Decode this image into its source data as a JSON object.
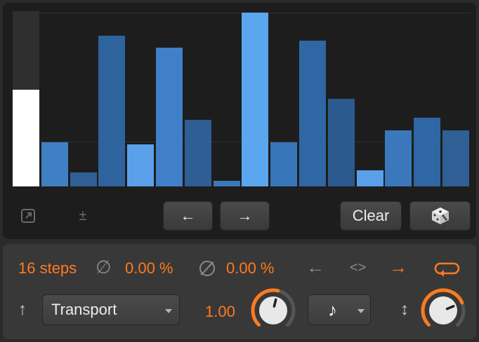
{
  "sequencer": {
    "step_levels": [
      0.55,
      0.25,
      0.08,
      0.86,
      0.24,
      0.79,
      0.38,
      0.03,
      0.99,
      0.25,
      0.83,
      0.5,
      0.09,
      0.32,
      0.39,
      0.32
    ],
    "step_colors": [
      "#ffffff",
      "#3f7fc4",
      "#2f5f94",
      "#2f639e",
      "#5aa0e8",
      "#3f80c8",
      "#2e5e93",
      "#3b78bb",
      "#5aa6ef",
      "#3776b8",
      "#2f66a4",
      "#2b5a8e",
      "#5aa0e8",
      "#3b78bb",
      "#2f66a4",
      "#2f5f94"
    ]
  },
  "toolbar": {
    "popout_icon": "popout-icon",
    "plusminus_label": "±",
    "shift_left_label": "←",
    "shift_right_label": "→",
    "clear_label": "Clear",
    "dice_icon": "dice-icon"
  },
  "bottom": {
    "steps_label": "16 steps",
    "param1_symbol": "∅",
    "param1_value": "0.00 %",
    "param2_value": "0.00 %",
    "arrow_left": "←",
    "arrow_both": "<>",
    "arrow_right": "→",
    "up_arrow": "↑",
    "source_select": "Transport",
    "rate_value": "1.00",
    "note_glyph": "♪",
    "updown_arrow": "↕"
  },
  "knobs": {
    "rate_level": 0.55,
    "depth_level": 0.75
  },
  "colors": {
    "accent": "#ff7a1f",
    "panel_dark": "#1d1d1d",
    "panel_mid": "#383838"
  }
}
